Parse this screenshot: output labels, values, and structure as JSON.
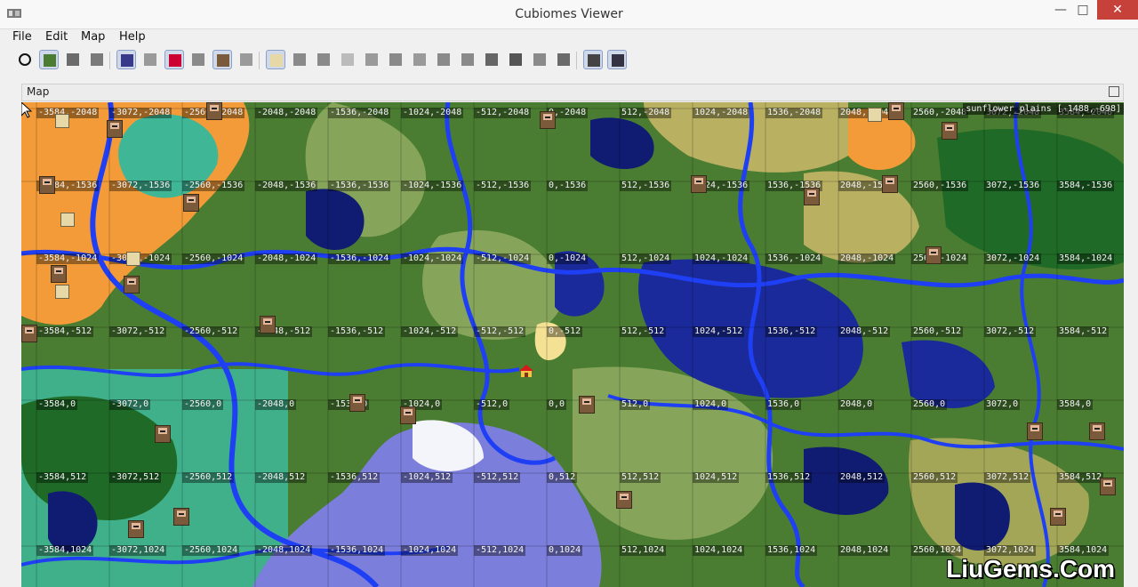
{
  "window": {
    "title": "Cubiomes Viewer",
    "minimize": "—",
    "maximize": "□",
    "close": "✕"
  },
  "menu": [
    "File",
    "Edit",
    "Map",
    "Help"
  ],
  "toolbar": {
    "buttons": [
      {
        "name": "locate-crosshair",
        "active": false
      },
      {
        "name": "layer-biome",
        "active": true
      },
      {
        "name": "layer-height",
        "active": false
      },
      {
        "name": "layer-shaded",
        "active": false
      },
      {
        "name": "grid",
        "active": true
      },
      {
        "name": "slime-chunks",
        "active": false
      },
      {
        "name": "spawn",
        "active": true
      },
      {
        "name": "strongholds",
        "active": false
      },
      {
        "name": "villages",
        "active": true
      },
      {
        "name": "mineshafts",
        "active": false
      },
      {
        "name": "desert-pyramid",
        "active": true
      },
      {
        "name": "jungle-temple",
        "active": false
      },
      {
        "name": "swamp-hut",
        "active": false
      },
      {
        "name": "igloo",
        "active": false
      },
      {
        "name": "ocean-monument",
        "active": false
      },
      {
        "name": "shipwreck",
        "active": false
      },
      {
        "name": "ocean-ruin",
        "active": false
      },
      {
        "name": "buried-treasure",
        "active": false
      },
      {
        "name": "woodland-mansion",
        "active": false
      },
      {
        "name": "outpost",
        "active": false
      },
      {
        "name": "ruined-portal",
        "active": false
      },
      {
        "name": "geode",
        "active": false
      },
      {
        "name": "ancient-city",
        "active": false
      },
      {
        "name": "nether-fortress",
        "active": true
      },
      {
        "name": "bastion",
        "active": true
      }
    ]
  },
  "map_panel": {
    "title": "Map",
    "biome_readout": "sunflower_plains [-1488,-698]"
  },
  "grid": {
    "x_values": [
      -3584,
      -3072,
      -2560,
      -2048,
      -1536,
      -1024,
      -512,
      0,
      512,
      1024,
      1536,
      2048,
      2560,
      3072,
      3584
    ],
    "z_values": [
      -2048,
      -1536,
      -1024,
      -512,
      0,
      512,
      1024
    ]
  },
  "colors": {
    "ocean": "#1a2a9a",
    "deep_ocean": "#101c72",
    "river": "#1f3ff5",
    "forest": "#1f6a26",
    "plains": "#86a55a",
    "savanna": "#b9b062",
    "badlands": "#f29b38",
    "beach": "#f4e193",
    "snow": "#f4f4fb",
    "frozen": "#7c7edc",
    "jungle": "#3fb696"
  },
  "watermark": "LiuGems.Com"
}
